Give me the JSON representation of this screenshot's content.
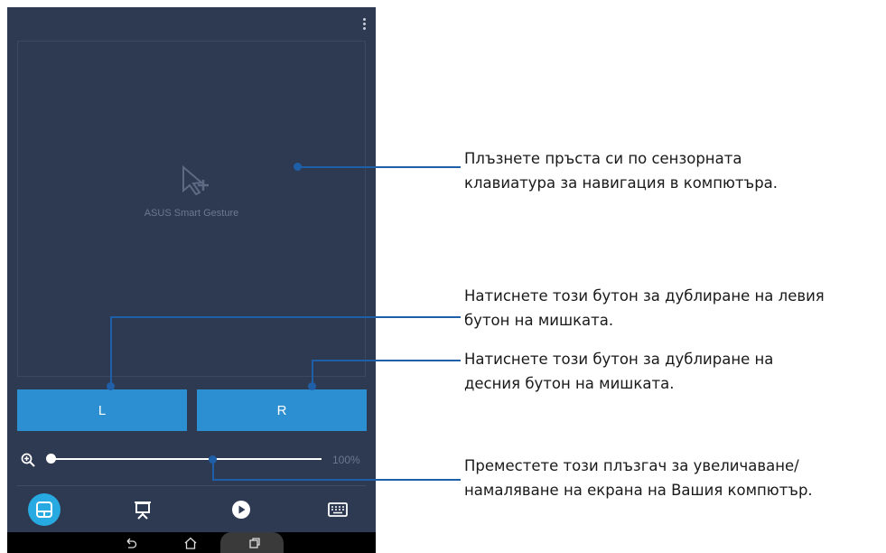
{
  "app": {
    "touchpad_label": "ASUS Smart Gesture",
    "left_button_label": "L",
    "right_button_label": "R",
    "zoom_value": "100%",
    "zoom_slider_fraction": 0.0
  },
  "icons": {
    "menu": "kebab-menu-icon",
    "zoom": "zoom-in-icon",
    "tabs": [
      "touchpad-icon",
      "presentation-icon",
      "play-icon",
      "keyboard-icon"
    ],
    "nav": [
      "back-icon",
      "home-icon",
      "recent-apps-icon"
    ]
  },
  "colors": {
    "screen_bg": "#2e3a52",
    "button_blue": "#2b8fd1",
    "active_tab": "#27a9e1",
    "callout": "#1f5fa8"
  },
  "callouts": {
    "touchpad": [
      "Плъзнете пръста си по сензорната",
      "клавиатура за навигация в компютъра."
    ],
    "left_button": [
      "Натиснете този бутон за дублиране на левия",
      "бутон на мишката."
    ],
    "right_button": [
      "Натиснете този бутон за дублиране на",
      "десния бутон на мишката."
    ],
    "zoom_slider": [
      "Преместете този плъзгач за увеличаване/",
      "намаляване на екрана на Вашия компютър."
    ]
  }
}
